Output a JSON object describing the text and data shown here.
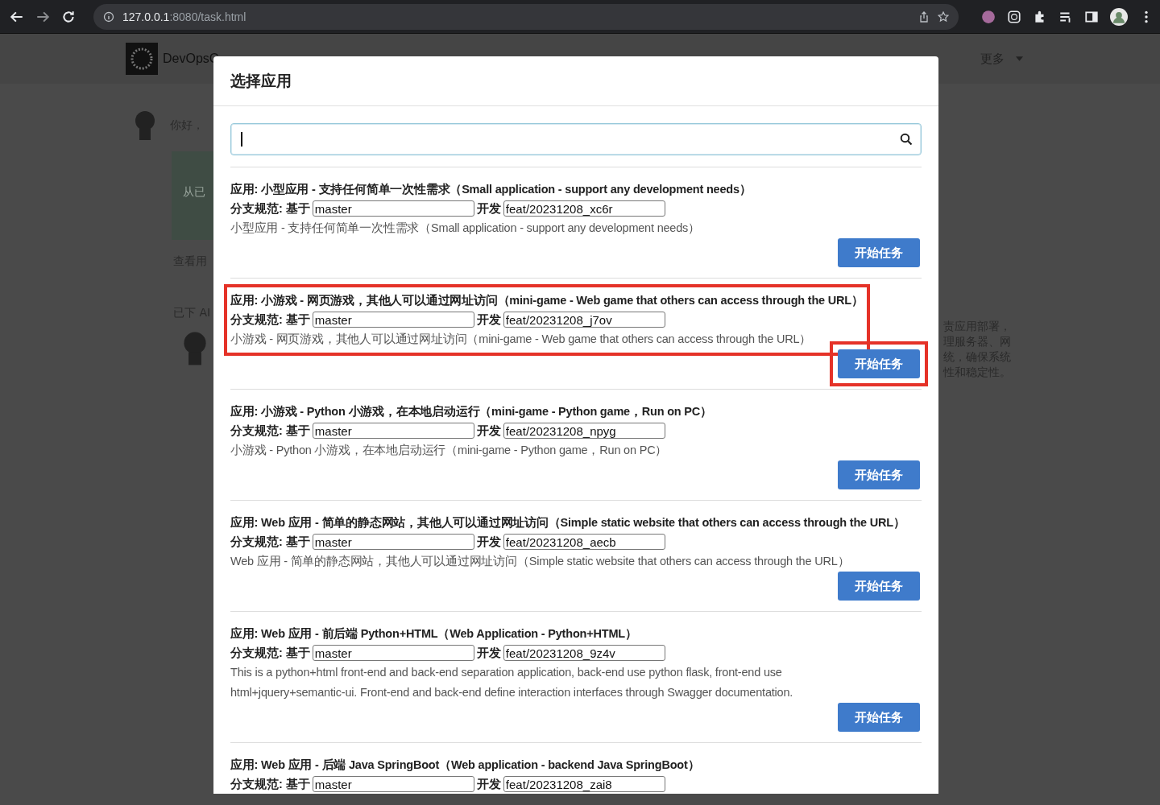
{
  "browser": {
    "url_host": "127.0.0.1",
    "url_rest": ":8080/task.html"
  },
  "background_page": {
    "brand": "DevOpsG",
    "more": "更多",
    "greeting": "你好，",
    "card_text": "从已",
    "link": "查看用",
    "section": "已下 AI",
    "side_lines": [
      "责应用部署，",
      "理服务器、网",
      "统，确保系统",
      "性和稳定性。"
    ]
  },
  "modal": {
    "title": "选择应用",
    "apps": [
      {
        "title": "应用: 小型应用 - 支持任何简单一次性需求（Small application - support any development needs）",
        "branch_label": "分支规范: 基于",
        "base": "master",
        "dev_label": "开发",
        "feature": "feat/20231208_xc6r",
        "description": "小型应用 - 支持任何简单一次性需求（Small application - support any development needs）",
        "button": "开始任务",
        "highlighted": false
      },
      {
        "title": "应用: 小游戏 - 网页游戏，其他人可以通过网址访问（mini-game - Web game that others can access through the URL）",
        "branch_label": "分支规范: 基于",
        "base": "master",
        "dev_label": "开发",
        "feature": "feat/20231208_j7ov",
        "description": "小游戏 - 网页游戏，其他人可以通过网址访问（mini-game - Web game that others can access through the URL）",
        "button": "开始任务",
        "highlighted": true
      },
      {
        "title": "应用: 小游戏 - Python 小游戏，在本地启动运行（mini-game - Python game，Run on PC）",
        "branch_label": "分支规范: 基于",
        "base": "master",
        "dev_label": "开发",
        "feature": "feat/20231208_npyg",
        "description": "小游戏 - Python 小游戏，在本地启动运行（mini-game - Python game，Run on PC）",
        "button": "开始任务",
        "highlighted": false
      },
      {
        "title": "应用: Web 应用 - 简单的静态网站，其他人可以通过网址访问（Simple static website that others can access through the URL）",
        "branch_label": "分支规范: 基于",
        "base": "master",
        "dev_label": "开发",
        "feature": "feat/20231208_aecb",
        "description": "Web 应用 - 简单的静态网站，其他人可以通过网址访问（Simple static website that others can access through the URL）",
        "button": "开始任务",
        "highlighted": false
      },
      {
        "title": "应用: Web 应用 - 前后端 Python+HTML（Web Application - Python+HTML）",
        "branch_label": "分支规范: 基于",
        "base": "master",
        "dev_label": "开发",
        "feature": "feat/20231208_9z4v",
        "description": "This is a python+html front-end and back-end separation application, back-end use python flask, front-end use html+jquery+semantic-ui. Front-end and back-end define interaction interfaces through Swagger documentation.",
        "button": "开始任务",
        "highlighted": false
      },
      {
        "title": "应用: Web 应用 - 后端 Java SpringBoot（Web application - backend Java SpringBoot）",
        "branch_label": "分支规范: 基于",
        "base": "master",
        "dev_label": "开发",
        "feature": "feat/20231208_zai8",
        "highlighted": false
      }
    ]
  }
}
